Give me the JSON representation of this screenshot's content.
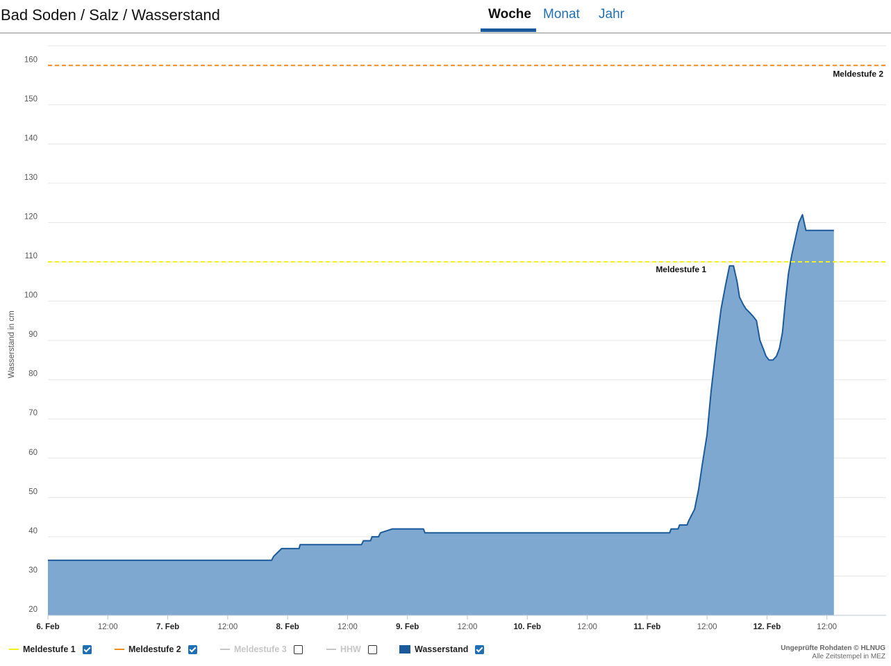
{
  "header": {
    "title": "Bad Soden / Salz / Wasserstand",
    "tabs": [
      {
        "label": "Woche",
        "active": true
      },
      {
        "label": "Monat",
        "active": false
      },
      {
        "label": "Jahr",
        "active": false
      }
    ]
  },
  "chart_data": {
    "type": "area",
    "ylabel": "Wasserstand in cm",
    "ylim": [
      20,
      165
    ],
    "yticks": [
      20,
      30,
      40,
      50,
      60,
      70,
      80,
      90,
      100,
      110,
      120,
      130,
      140,
      150,
      160
    ],
    "xlim_hours": [
      0,
      172
    ],
    "xticks": [
      {
        "h": 0,
        "label": "6. Feb",
        "bold": true
      },
      {
        "h": 12,
        "label": "12:00",
        "bold": false
      },
      {
        "h": 24,
        "label": "7. Feb",
        "bold": true
      },
      {
        "h": 36,
        "label": "12:00",
        "bold": false
      },
      {
        "h": 48,
        "label": "8. Feb",
        "bold": true
      },
      {
        "h": 60,
        "label": "12:00",
        "bold": false
      },
      {
        "h": 72,
        "label": "9. Feb",
        "bold": true
      },
      {
        "h": 84,
        "label": "12:00",
        "bold": false
      },
      {
        "h": 96,
        "label": "10. Feb",
        "bold": true
      },
      {
        "h": 108,
        "label": "12:00",
        "bold": false
      },
      {
        "h": 120,
        "label": "11. Feb",
        "bold": true
      },
      {
        "h": 132,
        "label": "12:00",
        "bold": false
      },
      {
        "h": 144,
        "label": "12. Feb",
        "bold": true
      },
      {
        "h": 156,
        "label": "12:00",
        "bold": false
      }
    ],
    "grid": true,
    "thresholds": [
      {
        "name": "Meldestufe 1",
        "value": 110,
        "color": "#f2f21a"
      },
      {
        "name": "Meldestufe 2",
        "value": 160,
        "color": "#f28c1a"
      }
    ],
    "series": [
      {
        "name": "Wasserstand",
        "color": "#1a5a9a",
        "fill": "#7ea8d0",
        "x_hours": [
          0,
          44.8,
          45.2,
          46.0,
          46.8,
          47.5,
          50.3,
          50.5,
          62.8,
          63.2,
          64.6,
          64.9,
          66.2,
          66.6,
          69.0,
          69.3,
          75.2,
          75.5,
          124.5,
          124.8,
          126.2,
          126.5,
          128.0,
          128.3,
          129.5,
          130.3,
          131.0,
          132.0,
          132.8,
          133.8,
          134.8,
          135.7,
          136.5,
          137.3,
          138.0,
          138.5,
          139.3,
          139.8,
          140.6,
          141.3,
          141.9,
          142.6,
          143.2,
          143.8,
          144.4,
          145.2,
          145.9,
          146.5,
          147.1,
          147.7,
          148.3,
          149.0,
          149.7,
          150.4,
          151.1,
          151.8,
          152.5,
          153.3,
          154.0,
          154.7,
          155.3,
          156.0,
          156.6,
          157.1,
          157.4
        ],
        "values": [
          34,
          34,
          35,
          36,
          37,
          37,
          37,
          38,
          38,
          39,
          39,
          40,
          40,
          41,
          42,
          42,
          42,
          41,
          41,
          42,
          42,
          43,
          43,
          44,
          47,
          52,
          58,
          66,
          77,
          88,
          98,
          104,
          109,
          109,
          105,
          101,
          99,
          98,
          97,
          96,
          95,
          90,
          88,
          86,
          85,
          85,
          86,
          88,
          92,
          100,
          107,
          112,
          116,
          120,
          122,
          118,
          118,
          118,
          118,
          118,
          118,
          118,
          118,
          118,
          118
        ]
      }
    ]
  },
  "legend": {
    "items": [
      {
        "label": "Meldestufe 1",
        "symbol": "line",
        "color": "#f2f21a",
        "checked": true,
        "disabled": false
      },
      {
        "label": "Meldestufe 2",
        "symbol": "line",
        "color": "#f28c1a",
        "checked": true,
        "disabled": false
      },
      {
        "label": "Meldestufe 3",
        "symbol": "line",
        "color": "#c6c6c6",
        "checked": false,
        "disabled": true
      },
      {
        "label": "HHW",
        "symbol": "line",
        "color": "#c6c6c6",
        "checked": false,
        "disabled": true
      },
      {
        "label": "Wasserstand",
        "symbol": "rect",
        "color": "#1a5a9a",
        "checked": true,
        "disabled": false
      }
    ]
  },
  "credits": {
    "line1": "Ungeprüfte Rohdaten © HLNUG",
    "line2": "Alle Zeitstempel in MEZ"
  }
}
